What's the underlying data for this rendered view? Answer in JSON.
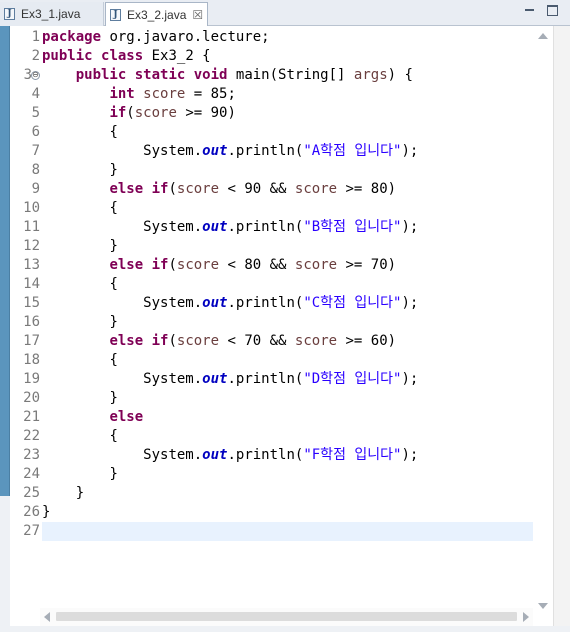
{
  "tabs": [
    {
      "label": "Ex3_1.java",
      "icon": "java-file-icon",
      "active": false
    },
    {
      "label": "Ex3_2.java",
      "icon": "java-file-icon",
      "active": true,
      "close": "☒"
    }
  ],
  "window_controls": {
    "minimize": "minimize-icon",
    "maximize": "maximize-icon"
  },
  "line_numbers": [
    "1",
    "2",
    "3",
    "4",
    "5",
    "6",
    "7",
    "8",
    "9",
    "10",
    "11",
    "12",
    "13",
    "14",
    "15",
    "16",
    "17",
    "18",
    "19",
    "20",
    "21",
    "22",
    "23",
    "24",
    "25",
    "26",
    "27"
  ],
  "code": {
    "l1": {
      "kw": "package",
      "rest": " org.javaro.lecture;"
    },
    "l2": {
      "kw1": "public",
      "kw2": "class",
      "rest": " Ex3_2 {"
    },
    "l3": {
      "kw1": "public",
      "kw2": "static",
      "kw3": "void",
      "mid": " main(String[] ",
      "var": "args",
      "end": ") {"
    },
    "l4": {
      "kw": "int",
      "var": "score",
      "rest": " = 85;"
    },
    "l5": {
      "kw": "if",
      "open": "(",
      "var": "score",
      "rest": " >= 90)"
    },
    "brace_open": "{",
    "brace_close": "}",
    "println": {
      "pre": "System.",
      "out": "out",
      "mid": ".println(",
      "end": ");"
    },
    "strings": [
      "\"A학점 입니다\"",
      "\"B학점 입니다\"",
      "\"C학점 입니다\"",
      "\"D학점 입니다\"",
      "\"F학점 입니다\""
    ],
    "else_if": {
      "kw1": "else",
      "kw2": "if",
      "open": "(",
      "var": "score"
    },
    "cond1": {
      "a": " < 90 && ",
      "b": " >= 80)"
    },
    "cond2": {
      "a": " < 80 && ",
      "b": " >= 70)"
    },
    "cond3": {
      "a": " < 70 && ",
      "b": " >= 60)"
    },
    "else": "else",
    "fold_marker": "⊖"
  },
  "colors": {
    "keyword": "#7f0055",
    "field": "#0000c0",
    "string": "#2a00ff",
    "local_var": "#6a3e3e",
    "current_line": "#e8f2fe",
    "change_bar": "#5b95bd"
  }
}
